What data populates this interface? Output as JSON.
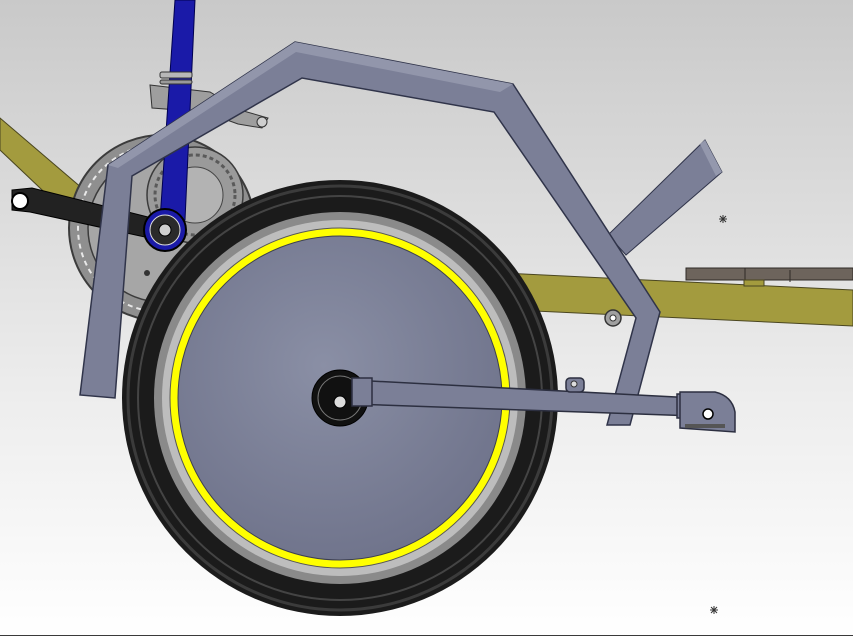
{
  "colors": {
    "background_top": "#c9c9c9",
    "background_bottom": "#ffffff",
    "frame_olive": "#a39b3e",
    "fender_slate": "#7b7f97",
    "seat_tube_blue": "#1a1aa8",
    "tire_black": "#1b1b1b",
    "rim_yellow": "#ffff00",
    "disc_slate": "#7c8196",
    "crank_black": "#222222",
    "sprocket_gray": "#8f8f8f",
    "rack_brown": "#6d645c"
  },
  "icons": {
    "origin_marker": "asterisk-marker-icon",
    "hub": "wheel-hub-icon",
    "bolt": "pivot-bolt-icon"
  }
}
